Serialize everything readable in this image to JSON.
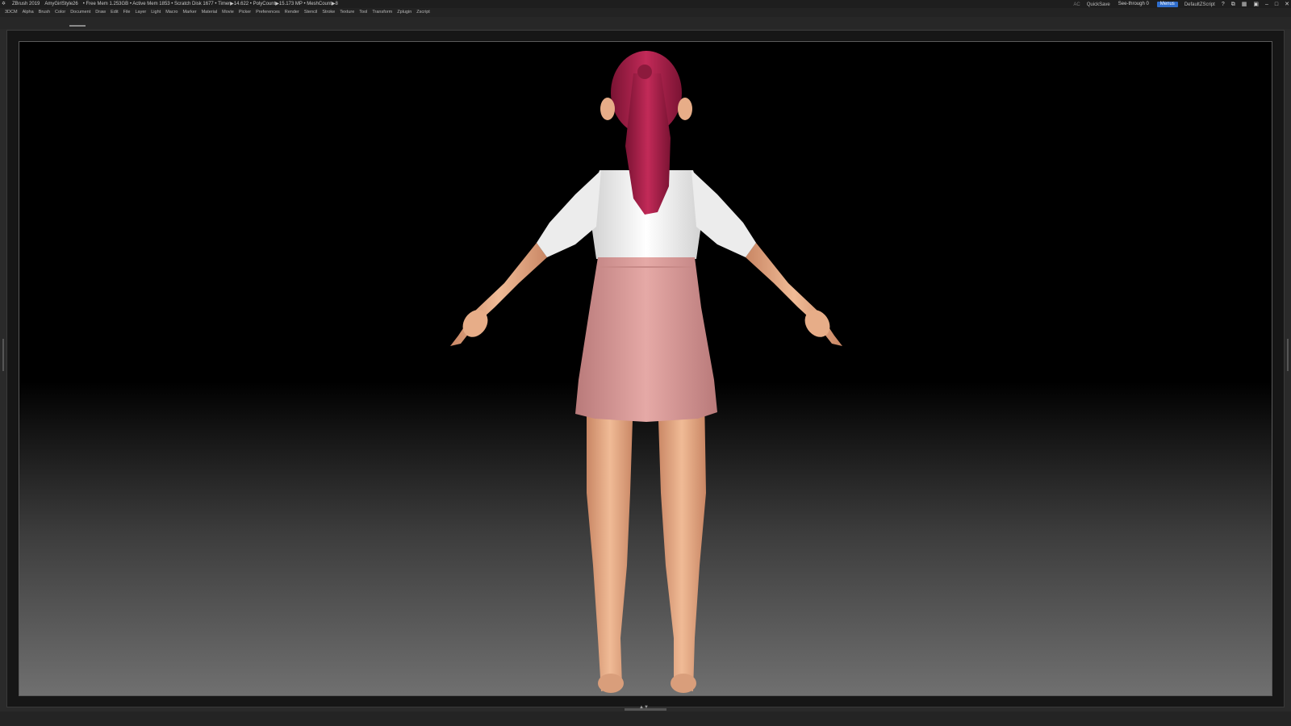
{
  "titlebar": {
    "app_name": "ZBrush 2019",
    "project": "AmyGirlStyle26",
    "stats": "• Free Mem 1.253GB • Active Mem 1853 • Scratch Disk 1677 • Timer▶14.622 • PolyCount▶15.173 MP • MeshCount▶8",
    "ac_label": "AC",
    "quicksave_label": "QuickSave",
    "see_through_label": "See-through 0",
    "see_through_value": 0,
    "menus_label": "Menus",
    "script_label": "DefaultZScript"
  },
  "menubar": {
    "items": [
      "3DCM",
      "Alpha",
      "Brush",
      "Color",
      "Document",
      "Draw",
      "Edit",
      "File",
      "Layer",
      "Light",
      "Macro",
      "Marker",
      "Material",
      "Movie",
      "Picker",
      "Preferences",
      "Render",
      "Stencil",
      "Stroke",
      "Texture",
      "Tool",
      "Transform",
      "Zplugin",
      "Zscript"
    ]
  },
  "icons": {
    "app": "zbrush-logo-icon",
    "window_controls": [
      "help-icon",
      "undock-icon",
      "layout-icon",
      "lock-icon",
      "minimize-icon",
      "maximize-icon",
      "close-icon"
    ]
  },
  "colors": {
    "accent_blue": "#2f6dcc",
    "see_through_bar": "#6fb52c",
    "hair": "#a8204a",
    "shirt": "#efefef",
    "skirt": "#d89999",
    "skin": "#e3ab86"
  }
}
